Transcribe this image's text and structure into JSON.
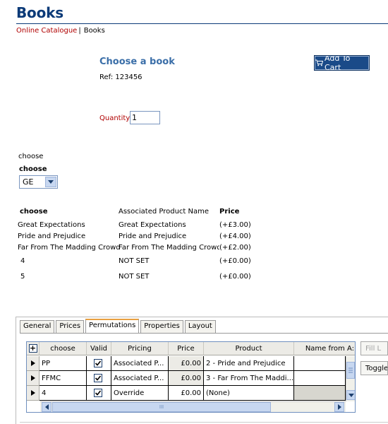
{
  "page": {
    "title": "Books",
    "breadcrumb": {
      "link": "Online Catalogue",
      "separator": "|",
      "current": "Books"
    }
  },
  "product": {
    "heading": "Choose a book",
    "ref": "Ref: 123456",
    "add_to_cart_label": "Add To Cart",
    "quantity_label": "Quantity:",
    "quantity_value": "1"
  },
  "choice": {
    "label_plain": "choose",
    "label_bold": "choose",
    "selected": "GE"
  },
  "summary_table": {
    "headers": [
      "choose",
      "Associated Product Name",
      "Price"
    ],
    "rows": [
      [
        "Great Expectations",
        "Great Expectations",
        "(+£3.00)"
      ],
      [
        "Pride and Prejudice",
        "Pride and Prejudice",
        "(+£4.00)"
      ],
      [
        "Far From The Madding Crowd",
        "Far From The Madding Crowd",
        "(+£2.00)"
      ],
      [
        "4",
        "NOT SET",
        "(+£0.00)"
      ],
      [
        "5",
        "NOT SET",
        "(+£0.00)"
      ]
    ]
  },
  "admin": {
    "tabs": [
      "General",
      "Prices",
      "Permutations",
      "Properties",
      "Layout"
    ],
    "active_tab": "Permutations",
    "grid": {
      "add_symbol": "+",
      "headers": [
        "choose",
        "Valid",
        "Pricing",
        "Price",
        "Product",
        "Name from A:"
      ],
      "rows": [
        [
          "PP",
          true,
          "Associated P...",
          "£0.00",
          "2 - Pride and Prejudice",
          ""
        ],
        [
          "FFMC",
          true,
          "Associated P...",
          "£0.00",
          "3 - Far From The Maddi...",
          ""
        ],
        [
          "4",
          true,
          "Override",
          "£0.00",
          "(None)",
          ""
        ]
      ],
      "hscroll_grip": "III"
    },
    "side_buttons": [
      "Fill L",
      "Toggle"
    ]
  },
  "colors": {
    "title": "#0b3a78",
    "link": "#b00000",
    "heading": "#3a6ea8",
    "button": "#1a4a88"
  }
}
